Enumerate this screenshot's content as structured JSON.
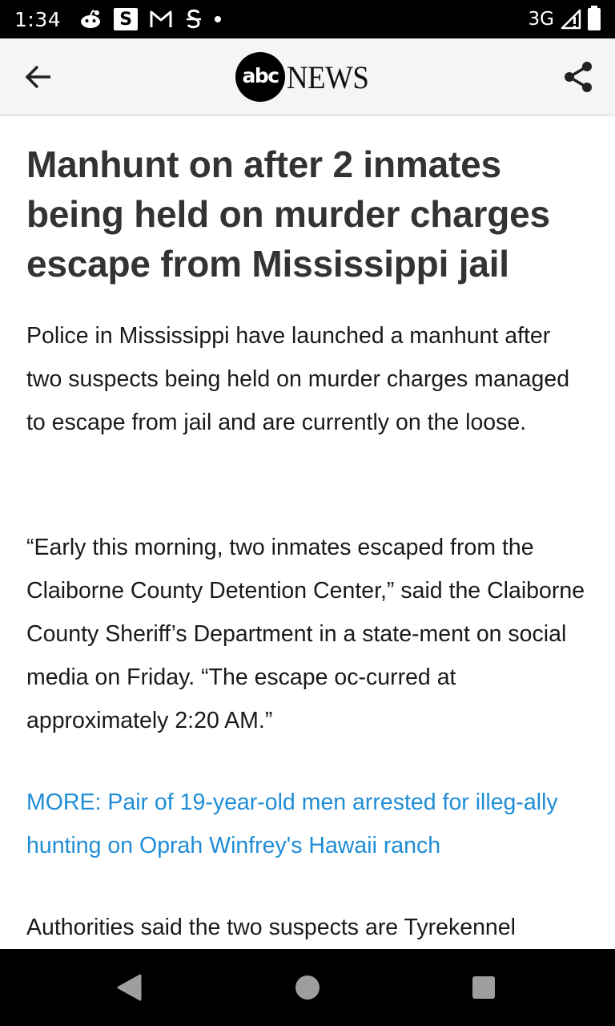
{
  "status_bar": {
    "time": "1:34",
    "network": "3G",
    "icons": [
      "reddit-icon",
      "s-app-icon",
      "gmail-icon",
      "mint-icon",
      "notification-dot-icon",
      "signal-icon",
      "battery-icon"
    ],
    "s_label": "S",
    "m_label": "M"
  },
  "app_bar": {
    "logo_abc": "abc",
    "logo_news": "NEWS",
    "back_icon": "arrow-back-icon",
    "share_icon": "share-icon"
  },
  "article": {
    "headline": "Manhunt on after 2 inmates being held on murder charges escape from Mississippi jail",
    "paragraphs": [
      "Police in Mississippi have launched a manhunt after two suspects being held on murder charges managed to escape from jail and are currently on the loose.",
      "“Early this morning, two inmates escaped from the Claiborne County Detention Center,” said the Claiborne County Sheriff’s Department in a state-ment on social media on Friday. “The escape oc-curred at approximately 2:20 AM.”",
      "MORE: Pair of 19-year-old men arrested for illeg-ally hunting on Oprah Winfrey's Hawaii ranch",
      "Authorities said the two suspects are Tyrekennel"
    ],
    "link_color": "#1f8dd6"
  },
  "nav_bar": {
    "buttons": [
      "back-triangle-icon",
      "home-circle-icon",
      "recents-square-icon"
    ]
  }
}
